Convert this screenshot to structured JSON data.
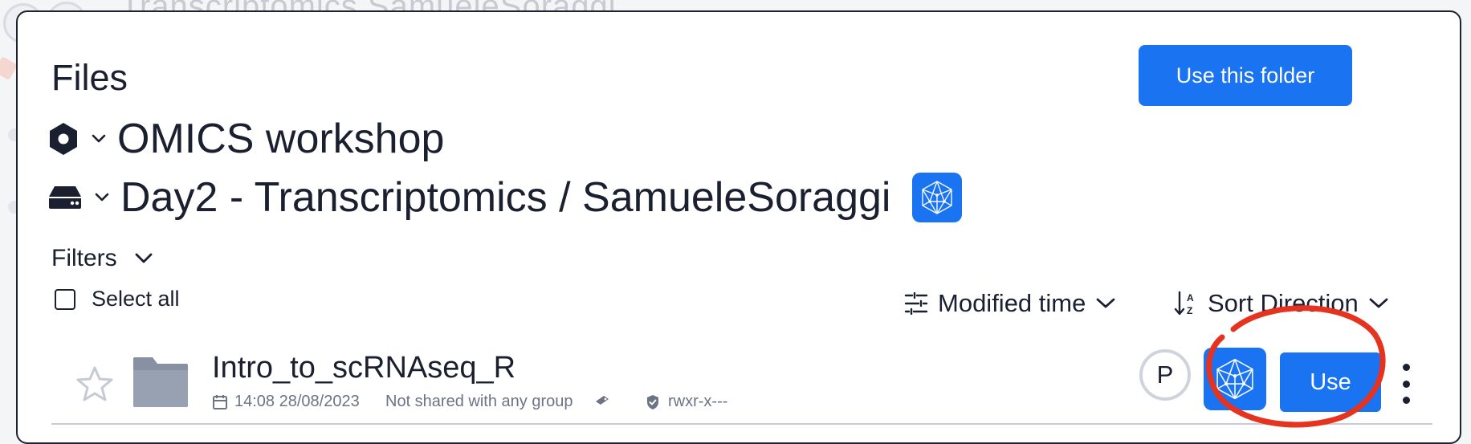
{
  "background": {
    "ghost_title": "Transcriptomics SamueleSoraggi"
  },
  "header": {
    "title": "Files",
    "use_folder_label": "Use this folder"
  },
  "path": {
    "project_icon": "hexagon-icon",
    "project_name": "OMICS workshop",
    "drive_icon": "drive-icon",
    "drive_path": "Day2 - Transcriptomics / SamueleSoraggi",
    "app_icon": "polyhedron-icon"
  },
  "controls": {
    "filters_label": "Filters",
    "select_all_label": "Select all",
    "sort_field_label": "Modified time",
    "sort_direction_label": "Sort Direction"
  },
  "files": [
    {
      "name": "Intro_to_scRNAseq_R",
      "icon": "folder-icon",
      "modified": "14:08 28/08/2023",
      "sharing": "Not shared with any group",
      "permissions": "rwxr-x---",
      "owner_initial": "P",
      "use_label": "Use"
    }
  ],
  "colors": {
    "accent": "#1a73f0",
    "annotation": "#e5331f",
    "text": "#1b2030",
    "muted": "#6b7384"
  }
}
